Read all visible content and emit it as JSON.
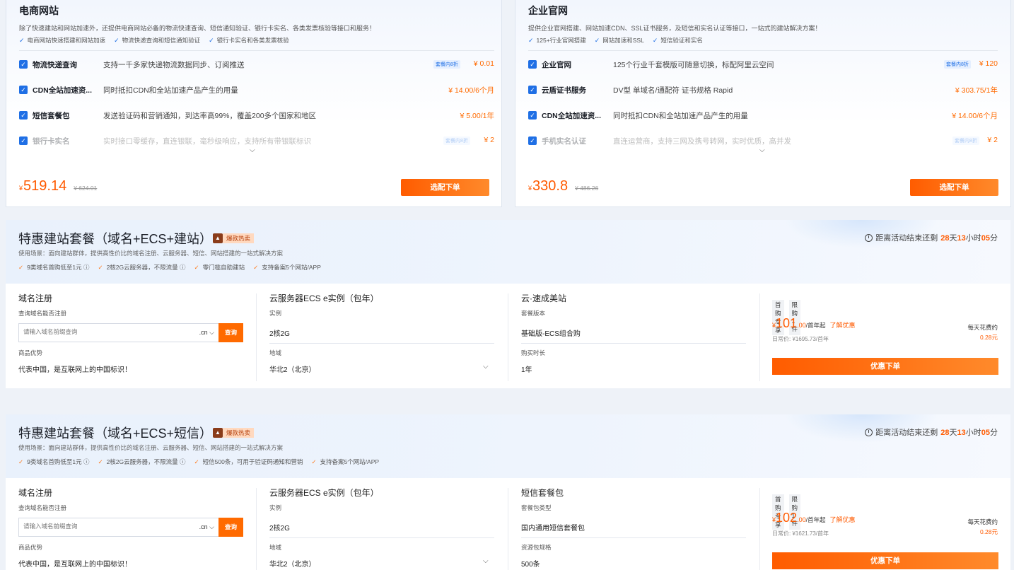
{
  "cards": [
    {
      "title": "电商网站",
      "desc": "除了快速建站和网站加速外，还提供电商网站必备的物流快速查询、短信通知验证、银行卡实名、各类发票核验等接口和服务！",
      "features": [
        "电商网站快速搭建和网站加速",
        "物流快递查询和短信通知验证",
        "银行卡实名和各类发票核验"
      ],
      "rows": [
        {
          "name": "物流快递查询",
          "desc": "支持一千多家快递物流数据同步、订阅推送",
          "tag": "套餐内8折",
          "price": "¥ 0.01"
        },
        {
          "name": "CDN全站加速资...",
          "desc": "同时抵扣CDN和全站加速产品产生的用量",
          "tag": "",
          "price": "¥ 14.00/6个月"
        },
        {
          "name": "短信套餐包",
          "desc": "发送验证码和营销通知，到达率高99%，覆盖200多个国家和地区",
          "tag": "",
          "price": "¥ 5.00/1年"
        },
        {
          "name": "银行卡实名",
          "desc": "实时接口零缓存，直连银联，毫秒级响应，支持所有带银联标识",
          "tag": "套餐内8折",
          "price": "¥ 2"
        }
      ],
      "total_yen": "¥",
      "total": "519.14",
      "old_price": "¥ 624.01",
      "button": "选配下单"
    },
    {
      "title": "企业官网",
      "desc": "提供企业官网搭建、网站加速CDN、SSL证书服务，及短信和实名认证等接口，一站式的建站解决方案！",
      "features": [
        "125+行业官网搭建",
        "网站加速和SSL",
        "短信验证和实名"
      ],
      "rows": [
        {
          "name": "企业官网",
          "desc": "125个行业千套模版可随意切换，标配阿里云空间",
          "tag": "套餐内8折",
          "price": "¥ 120"
        },
        {
          "name": "云盾证书服务",
          "desc": "DV型 单域名/通配符 证书规格 Rapid",
          "tag": "",
          "price": "¥ 303.75/1年"
        },
        {
          "name": "CDN全站加速资...",
          "desc": "同时抵扣CDN和全站加速产品产生的用量",
          "tag": "",
          "price": "¥ 14.00/6个月"
        },
        {
          "name": "手机实名认证",
          "desc": "直连运营商，支持三网及携号转网，实时优质，高并发",
          "tag": "套餐内8折",
          "price": "¥ 2"
        }
      ],
      "total_yen": "¥",
      "total": "330.8",
      "old_price": "¥ 486.26",
      "button": "选配下单"
    }
  ],
  "bundles": [
    {
      "title": "特惠建站套餐（域名+ECS+建站）",
      "hot": "爆款热卖",
      "scene": "使用场景：面向建站群体，提供高性价比的域名注册、云服务器、短信、网站搭建的一站式解决方案",
      "features": [
        "9类域名首购低至1元 ⓘ",
        "2核2G云服务器，不限流量 ⓘ",
        "零门槛自助建站",
        "支持备案5个网站/APP"
      ],
      "countdown": {
        "prefix": "距离活动结束还剩",
        "days": "28",
        "d_unit": "天",
        "hours": "13",
        "h_unit": "小时",
        "mins": "05",
        "m_unit": "分"
      },
      "domain": {
        "title": "域名注册",
        "label": "查询域名能否注册",
        "placeholder": "请输入域名前缀查询",
        "suffix": ".cn ⌵",
        "button": "查询",
        "adv_label": "商品优势",
        "adv": "代表中国，是互联网上的中国标识！"
      },
      "ecs": {
        "title": "云服务器ECS e实例（包年）",
        "l1": "实例",
        "v1": "2核2G",
        "l2": "地域",
        "v2": "华北2（北京）"
      },
      "third": {
        "title": "云·速成美站",
        "l1": "套餐版本",
        "v1": "基础版-ECS组合购",
        "l2": "购买时长",
        "v2": "1年"
      },
      "buy": {
        "tag1": "首购专享",
        "tag2": "限购1件",
        "yen": "¥",
        "price": "101",
        "dec": ".00",
        "unit": "/首年起",
        "more": "了解优惠",
        "orig": "日常价: ¥1695.73/首年",
        "daily_label": "每天花费约",
        "daily": "0.28元",
        "button": "优惠下单"
      }
    },
    {
      "title": "特惠建站套餐（域名+ECS+短信）",
      "hot": "爆款热卖",
      "scene": "使用场景：面向建站群体，提供高性价比的域名注册、云服务器、短信、网站搭建的一站式解决方案",
      "features": [
        "9类域名首购低至1元 ⓘ",
        "2核2G云服务器，不限流量 ⓘ",
        "短信500条，可用于验证码通知和营销",
        "支持备案5个网站/APP"
      ],
      "countdown": {
        "prefix": "距离活动结束还剩",
        "days": "28",
        "d_unit": "天",
        "hours": "13",
        "h_unit": "小时",
        "mins": "05",
        "m_unit": "分"
      },
      "domain": {
        "title": "域名注册",
        "label": "查询域名能否注册",
        "placeholder": "请输入域名前缀查询",
        "suffix": ".cn ⌵",
        "button": "查询",
        "adv_label": "商品优势",
        "adv": "代表中国，是互联网上的中国标识！"
      },
      "ecs": {
        "title": "云服务器ECS e实例（包年）",
        "l1": "实例",
        "v1": "2核2G",
        "l2": "地域",
        "v2": "华北2（北京）"
      },
      "third": {
        "title": "短信套餐包",
        "l1": "套餐包类型",
        "v1": "国内通用短信套餐包",
        "l2": "资源包规格",
        "v2": "500条"
      },
      "buy": {
        "tag1": "首购专享",
        "tag2": "限购1件",
        "yen": "¥",
        "price": "102",
        "dec": ".00",
        "unit": "/首年起",
        "more": "了解优惠",
        "orig": "日常价: ¥1621.73/首年",
        "daily_label": "每天花费约",
        "daily": "0.28元",
        "button": "优惠下单"
      }
    }
  ],
  "icons": {
    "check": "check-icon",
    "chevron": "chevron-down-icon",
    "clock": "clock-icon",
    "fire": "fire-icon"
  },
  "colors": {
    "accent": "#ff6a00",
    "primary": "#1f6fe5"
  }
}
